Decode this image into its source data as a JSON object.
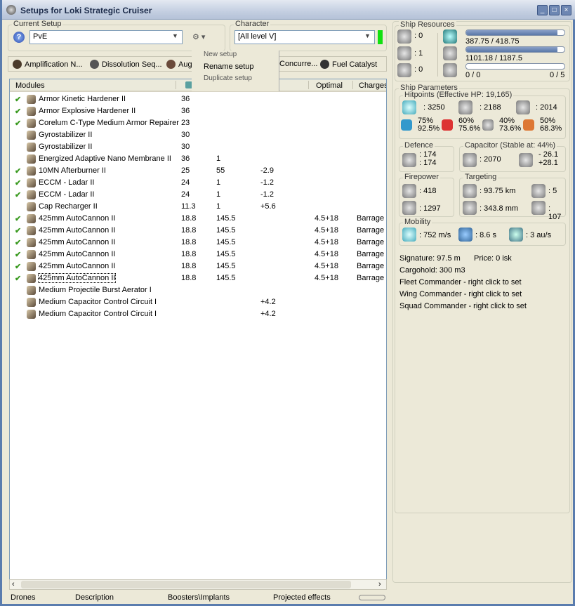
{
  "window": {
    "title": "Setups for Loki Strategic Cruiser",
    "min": "_",
    "max": "□",
    "close": "×"
  },
  "setup": {
    "label": "Current Setup",
    "value": "PvE"
  },
  "character": {
    "label": "Character",
    "value": "[All level V]"
  },
  "subsystems": [
    "Amplification N...",
    "Dissolution Seq...",
    "Aug",
    "Concurre...",
    "Fuel Catalyst"
  ],
  "menu": {
    "items": [
      "New setup",
      "Rename setup",
      "Duplicate setup"
    ]
  },
  "table": {
    "headers": {
      "modules": "Modules",
      "optimal": "Optimal",
      "charges": "Charges"
    },
    "rows": [
      {
        "on": true,
        "name": "Armor Kinetic Hardener II",
        "c1": "36",
        "c2": "",
        "c3": "",
        "opt": "",
        "chg": ""
      },
      {
        "on": true,
        "name": "Armor Explosive Hardener II",
        "c1": "36",
        "c2": "",
        "c3": "",
        "opt": "",
        "chg": ""
      },
      {
        "on": true,
        "name": "Corelum C-Type Medium Armor Repairer",
        "c1": "23",
        "c2": "",
        "c3": "",
        "opt": "",
        "chg": ""
      },
      {
        "on": false,
        "name": "Gyrostabilizer II",
        "c1": "30",
        "c2": "",
        "c3": "",
        "opt": "",
        "chg": ""
      },
      {
        "on": false,
        "name": "Gyrostabilizer II",
        "c1": "30",
        "c2": "",
        "c3": "",
        "opt": "",
        "chg": ""
      },
      {
        "on": false,
        "name": "Energized Adaptive Nano Membrane II",
        "c1": "36",
        "c2": "1",
        "c3": "",
        "opt": "",
        "chg": ""
      },
      {
        "on": true,
        "name": "10MN Afterburner II",
        "c1": "25",
        "c2": "55",
        "c3": "-2.9",
        "opt": "",
        "chg": ""
      },
      {
        "on": true,
        "name": "ECCM - Ladar II",
        "c1": "24",
        "c2": "1",
        "c3": "-1.2",
        "opt": "",
        "chg": ""
      },
      {
        "on": true,
        "name": "ECCM - Ladar II",
        "c1": "24",
        "c2": "1",
        "c3": "-1.2",
        "opt": "",
        "chg": ""
      },
      {
        "on": false,
        "name": "Cap Recharger II",
        "c1": "11.3",
        "c2": "1",
        "c3": "+5.6",
        "opt": "",
        "chg": ""
      },
      {
        "on": true,
        "name": "425mm AutoCannon II",
        "c1": "18.8",
        "c2": "145.5",
        "c3": "",
        "opt": "4.5+18",
        "chg": "Barrage I"
      },
      {
        "on": true,
        "name": "425mm AutoCannon II",
        "c1": "18.8",
        "c2": "145.5",
        "c3": "",
        "opt": "4.5+18",
        "chg": "Barrage I"
      },
      {
        "on": true,
        "name": "425mm AutoCannon II",
        "c1": "18.8",
        "c2": "145.5",
        "c3": "",
        "opt": "4.5+18",
        "chg": "Barrage I"
      },
      {
        "on": true,
        "name": "425mm AutoCannon II",
        "c1": "18.8",
        "c2": "145.5",
        "c3": "",
        "opt": "4.5+18",
        "chg": "Barrage I"
      },
      {
        "on": true,
        "name": "425mm AutoCannon II",
        "c1": "18.8",
        "c2": "145.5",
        "c3": "",
        "opt": "4.5+18",
        "chg": "Barrage I"
      },
      {
        "on": true,
        "name": "425mm AutoCannon II",
        "c1": "18.8",
        "c2": "145.5",
        "c3": "",
        "opt": "4.5+18",
        "chg": "Barrage I"
      },
      {
        "on": false,
        "name": "Medium Projectile Burst Aerator I",
        "c1": "",
        "c2": "",
        "c3": "",
        "opt": "",
        "chg": ""
      },
      {
        "on": false,
        "name": "Medium Capacitor Control Circuit I",
        "c1": "",
        "c2": "",
        "c3": "+4.2",
        "opt": "",
        "chg": ""
      },
      {
        "on": false,
        "name": "Medium Capacitor Control Circuit I",
        "c1": "",
        "c2": "",
        "c3": "+4.2",
        "opt": "",
        "chg": ""
      }
    ]
  },
  "tabs": [
    "Drones",
    "Description",
    "Boosters\\Implants",
    "Projected effects"
  ],
  "resources": {
    "label": "Ship Resources",
    "turrets": ": 0",
    "launchers": ": 1",
    "calibration": ": 0",
    "cpu": "387.75 / 418.75",
    "cpu_frac": 0.926,
    "power": "1101.18 / 1187.5",
    "power_frac": 0.927,
    "drone_bw": "0 / 0",
    "drone_frac": 0,
    "drones": "0 / 5"
  },
  "params": {
    "label": "Ship Parameters",
    "hp": {
      "label": "Hitpoints (Effective HP: 19,165)",
      "shield": ": 3250",
      "armor": ": 2188",
      "structure": ": 2014",
      "res": [
        [
          "75%",
          "92.5%"
        ],
        [
          "60%",
          "75.6%"
        ],
        [
          "40%",
          "73.6%"
        ],
        [
          "50%",
          "68.3%"
        ]
      ]
    },
    "defence": {
      "label": "Defence",
      "a": ": 174",
      "b": ": 174"
    },
    "capacitor": {
      "label": "Capacitor (Stable at: 44%)",
      "cap": ": 2070",
      "use": "- 26.1",
      "regen": "+28.1"
    },
    "firepower": {
      "label": "Firepower",
      "dps": ": 418",
      "volley": ": 1297"
    },
    "targeting": {
      "label": "Targeting",
      "range": ": 93.75 km",
      "targets": ": 5",
      "sig_res": ": 343.8 mm",
      "scan": ": 107"
    },
    "mobility": {
      "label": "Mobility",
      "speed": ": 752 m/s",
      "align": ": 8.6 s",
      "warp": ": 3 au/s"
    },
    "signature": "Signature: 97.5 m",
    "price": "Price: 0 isk",
    "cargo": "Cargohold: 300 m3",
    "fleet": "Fleet Commander - right click to set",
    "wing": "Wing Commander - right click to set",
    "squad": "Squad Commander - right click to set"
  }
}
